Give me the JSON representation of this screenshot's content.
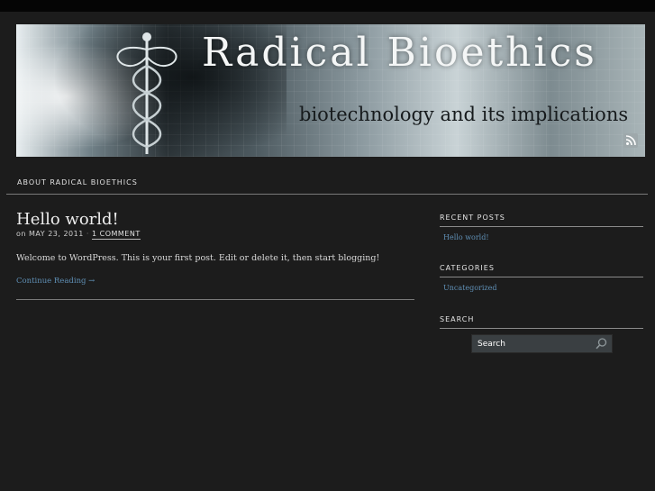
{
  "site": {
    "title": "Radical Bioethics",
    "tagline": "biotechnology and its implications"
  },
  "nav": {
    "items": [
      {
        "label": "About Radical Bioethics"
      }
    ]
  },
  "post": {
    "title": "Hello world!",
    "meta_prefix": "on",
    "date": "May 23, 2011",
    "separator": "·",
    "comments": "1 Comment",
    "body": "Welcome to WordPress. This is your first post. Edit or delete it, then start blogging!",
    "more": "Continue Reading →"
  },
  "sidebar": {
    "recent_posts": {
      "title": "Recent Posts",
      "items": [
        "Hello world!"
      ]
    },
    "categories": {
      "title": "Categories",
      "items": [
        "Uncategorized"
      ]
    },
    "search": {
      "title": "Search",
      "placeholder": "Search"
    }
  },
  "icons": {
    "rss": "rss-icon",
    "search": "search-icon"
  },
  "colors": {
    "background": "#1c1c1c",
    "link": "#5f8fb5",
    "text": "#d8d8d8"
  }
}
